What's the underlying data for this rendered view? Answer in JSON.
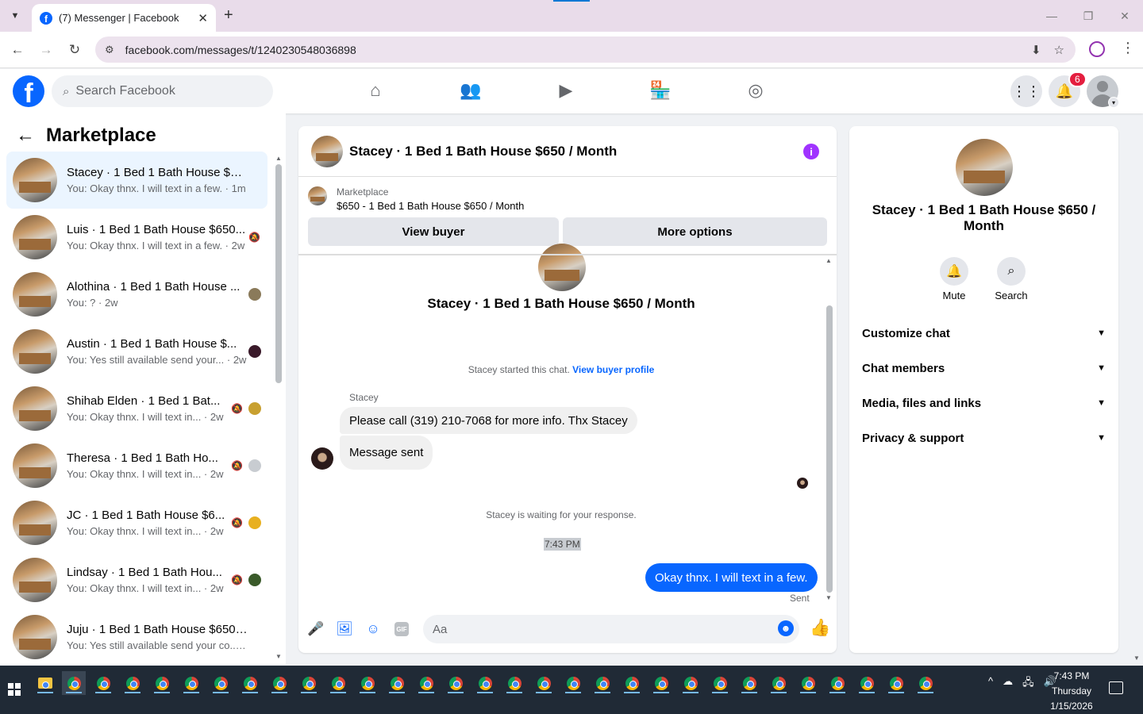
{
  "browser": {
    "tab_title": "(7) Messenger | Facebook",
    "url": "facebook.com/messages/t/1240230548036898"
  },
  "header": {
    "search_placeholder": "Search Facebook",
    "notification_count": "6"
  },
  "sidebar": {
    "title": "Marketplace",
    "conversations": [
      {
        "name": "Stacey · 1 Bed 1 Bath House $65...",
        "preview": "You: Okay thnx. I will text in a few. · 1m"
      },
      {
        "name": "Luis · 1 Bed 1 Bath House $650...",
        "preview": "You: Okay thnx. I will text in a few. · 2w"
      },
      {
        "name": "Alothina · 1 Bed 1 Bath House ...",
        "preview": "You: ? · 2w"
      },
      {
        "name": "Austin · 1 Bed 1 Bath House $...",
        "preview": "You: Yes still available send your... · 2w"
      },
      {
        "name": "Shihab Elden · 1 Bed 1 Bat...",
        "preview": "You: Okay thnx. I will text in... · 2w"
      },
      {
        "name": "Theresa · 1 Bed 1 Bath Ho...",
        "preview": "You: Okay thnx. I will text in... · 2w"
      },
      {
        "name": "JC · 1 Bed 1 Bath House $6...",
        "preview": "You: Okay thnx. I will text in... · 2w"
      },
      {
        "name": "Lindsay · 1 Bed 1 Bath Hou...",
        "preview": "You: Okay thnx. I will text in... · 2w"
      },
      {
        "name": "Juju · 1 Bed 1 Bath House $650 / ...",
        "preview": "You: Yes still available send your co... · 2w"
      }
    ]
  },
  "chat": {
    "title": "Stacey · 1 Bed 1 Bath House $650 / Month",
    "listing_label": "Marketplace",
    "listing_price": "$650 - 1 Bed 1 Bath House $650 / Month",
    "view_buyer": "View buyer",
    "more_options": "More options",
    "started_text": "Stacey started this chat.",
    "view_buyer_profile": "View buyer profile",
    "sender": "Stacey",
    "msg1": "Please call (319) 210-7068 for more info. Thx Stacey",
    "msg2": "Message sent",
    "waiting": "Stacey is waiting for your response.",
    "time": "7:43 PM",
    "msg_out": "Okay thnx. I will text in a few.",
    "sent": "Sent",
    "composer_placeholder": "Aa"
  },
  "right_panel": {
    "name": "Stacey · 1 Bed 1 Bath House $650 / Month",
    "mute": "Mute",
    "search": "Search",
    "sections": [
      "Customize chat",
      "Chat members",
      "Media, files and links",
      "Privacy & support"
    ]
  },
  "taskbar": {
    "time": "7:43 PM",
    "day": "Thursday",
    "date": "1/15/2026"
  }
}
